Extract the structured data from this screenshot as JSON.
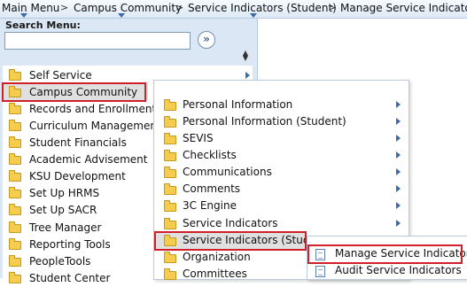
{
  "breadcrumb": [
    "Main Menu",
    "Campus Community",
    "Service Indicators (Student)",
    "Manage Service Indicators"
  ],
  "search": {
    "label": "Search Menu:",
    "value": "",
    "go_glyph": "»"
  },
  "menu_items": [
    "Self Service",
    "Campus Community",
    "Records and Enrollment",
    "Curriculum Management",
    "Student Financials",
    "Academic Advisement",
    "KSU Development",
    "Set Up HRMS",
    "Set Up SACR",
    "Tree Manager",
    "Reporting Tools",
    "PeopleTools",
    "Student Center"
  ],
  "campus_community_items": [
    "Personal Information",
    "Personal Information (Student)",
    "SEVIS",
    "Checklists",
    "Communications",
    "Comments",
    "3C Engine",
    "Service Indicators",
    "Service Indicators (Student)",
    "Organization",
    "Committees"
  ],
  "service_indicator_items": [
    "Manage Service Indicators",
    "Audit Service Indicators"
  ],
  "colors": {
    "highlight": "#d0202a",
    "accent": "#3b6aa6",
    "pane": "#dbe7f4"
  },
  "icons": [
    "folder-icon",
    "chevron-right-icon",
    "document-icon",
    "sort-arrows-icon"
  ]
}
